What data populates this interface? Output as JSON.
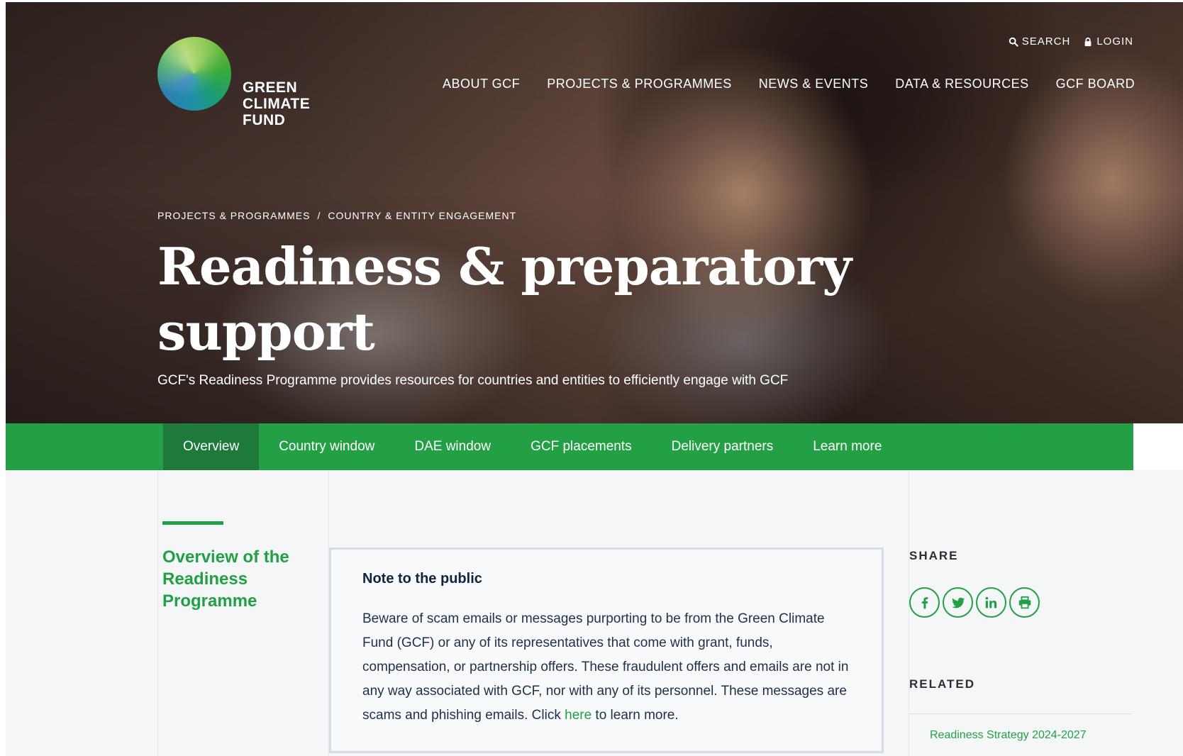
{
  "logo": {
    "lines": [
      "GREEN",
      "CLIMATE",
      "FUND"
    ]
  },
  "top_links": {
    "search": "SEARCH",
    "login": "LOGIN"
  },
  "main_nav": [
    "ABOUT GCF",
    "PROJECTS & PROGRAMMES",
    "NEWS & EVENTS",
    "DATA & RESOURCES",
    "GCF BOARD"
  ],
  "breadcrumb": {
    "items": [
      "PROJECTS & PROGRAMMES",
      "COUNTRY & ENTITY ENGAGEMENT"
    ],
    "separator": "/"
  },
  "hero": {
    "title_line1": "Readiness & preparatory",
    "title_line2": "support",
    "subtitle": "GCF's Readiness Programme provides resources for countries and entities to efficiently engage with GCF"
  },
  "subnav": {
    "tabs": [
      "Overview",
      "Country window",
      "DAE window",
      "GCF placements",
      "Delivery partners",
      "Learn more"
    ],
    "active": "Overview"
  },
  "sidebar": {
    "heading": "Overview of the Readiness Programme"
  },
  "note": {
    "title": "Note to the public",
    "body_before": "Beware of scam emails or messages purporting to be from the Green Climate Fund (GCF) or any of its representatives that come with grant, funds, compensation, or partnership offers. These fraudulent offers and emails are not in any way associated with GCF, nor with any of its personnel. These messages are scams and phishing emails. Click ",
    "link_text": "here",
    "body_after": " to learn more."
  },
  "share": {
    "title": "SHARE",
    "icons": [
      "facebook-icon",
      "twitter-icon",
      "linkedin-icon",
      "print-icon"
    ]
  },
  "related": {
    "title": "RELATED",
    "links": [
      "Readiness Strategy 2024-2027"
    ]
  },
  "colors": {
    "brand_green": "#23a045",
    "active_tab": "#1d7a3a",
    "content_bg": "#f4f6f8"
  }
}
